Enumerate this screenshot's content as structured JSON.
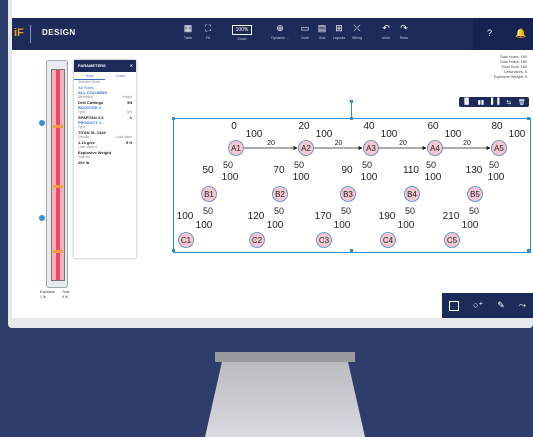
{
  "app": {
    "brand": "iF",
    "title": "DESIGN"
  },
  "toolbar": [
    {
      "icon": "table-icon",
      "glyph": "▦",
      "label": "Table"
    },
    {
      "icon": "fit-icon",
      "glyph": "⛶",
      "label": "Fit"
    },
    {
      "icon": "zoom-icon",
      "glyph": "",
      "label": "Zoom"
    },
    {
      "icon": "crosshair-icon",
      "glyph": "⊕",
      "label": "Dynamic ..."
    },
    {
      "icon": "note-icon",
      "glyph": "▭",
      "label": "Note"
    },
    {
      "icon": "grid-icon",
      "glyph": "▤",
      "label": "Grid"
    },
    {
      "icon": "layout-icon",
      "glyph": "⊞",
      "label": "Layouts"
    },
    {
      "icon": "wiring-icon",
      "glyph": "⤫",
      "label": "Wiring"
    },
    {
      "icon": "undo-icon",
      "glyph": "↶",
      "label": "Undo"
    },
    {
      "icon": "redo-icon",
      "glyph": "↷",
      "label": "Redo"
    }
  ],
  "zoom": {
    "value": "100%"
  },
  "stats": [
    "Total Holes: 180",
    "Total Holes: 180",
    "Total Tons: 180",
    "Detonators: 0",
    "Explosive Weight: 0"
  ],
  "panel": {
    "title": "PARAMETERS",
    "tabs": [
      "Hole",
      "Load"
    ],
    "filter_label": "Selected Holes",
    "filter_value": "All Holes",
    "section1": "ALL COLUMNS",
    "s1_labels": [
      "Stemming",
      "Height"
    ],
    "s1_values": [
      "Drill Cuttings",
      "5ft"
    ],
    "section2": "BOOSTER 1",
    "s2_labels": [
      "Type",
      "Qty"
    ],
    "s2_values": [
      "SPARTAN 2.5",
      "1"
    ],
    "section3": "PRODUCT 1",
    "s3_type_label": "Type",
    "s3_type_value": "TITAN XL 1334",
    "s3_labels": [
      "Density",
      "Load Value"
    ],
    "s3_values": [
      "1.14 g/cc",
      "5 ft"
    ],
    "s3_calc_label": "Load Value #",
    "s3_calc_value": "Explosive Weight",
    "s3_total_label": "Total Wt",
    "s3_total_value": "20# lb"
  },
  "column_legend": {
    "left": [
      "Explosive",
      "1 lb"
    ],
    "right": [
      "Tons",
      "9 lb"
    ]
  },
  "diagram": {
    "row_a": [
      {
        "id": "A1",
        "time": "0",
        "weight": "100"
      },
      {
        "id": "A2",
        "time": "20",
        "weight": "100"
      },
      {
        "id": "A3",
        "time": "40",
        "weight": "100"
      },
      {
        "id": "A4",
        "time": "60",
        "weight": "100"
      },
      {
        "id": "A5",
        "time": "80",
        "weight": "100"
      }
    ],
    "row_a_arrows": [
      "20",
      "20",
      "20",
      "20"
    ],
    "row_b": [
      {
        "id": "B1",
        "time": "50",
        "delay": "50",
        "weight": "100"
      },
      {
        "id": "B2",
        "time": "70",
        "delay": "50",
        "weight": "100"
      },
      {
        "id": "B3",
        "time": "90",
        "delay": "50",
        "weight": "100"
      },
      {
        "id": "B4",
        "time": "110",
        "delay": "50",
        "weight": "100"
      },
      {
        "id": "B5",
        "time": "130",
        "delay": "50",
        "weight": "100"
      }
    ],
    "row_c": [
      {
        "id": "C1",
        "time": "100",
        "delay": "50",
        "weight": "100"
      },
      {
        "id": "C2",
        "time": "120",
        "delay": "50",
        "weight": "100"
      },
      {
        "id": "C3",
        "time": "170",
        "delay": "50",
        "weight": "100"
      },
      {
        "id": "C4",
        "time": "190",
        "delay": "50",
        "weight": "100"
      },
      {
        "id": "C5",
        "time": "210",
        "delay": "50",
        "weight": "100"
      }
    ]
  },
  "colors": {
    "navy": "#1d2b5a",
    "accent": "#2f8fc9",
    "hole_fill": "#f4c6cf",
    "hole_stroke": "#4a88c7"
  }
}
